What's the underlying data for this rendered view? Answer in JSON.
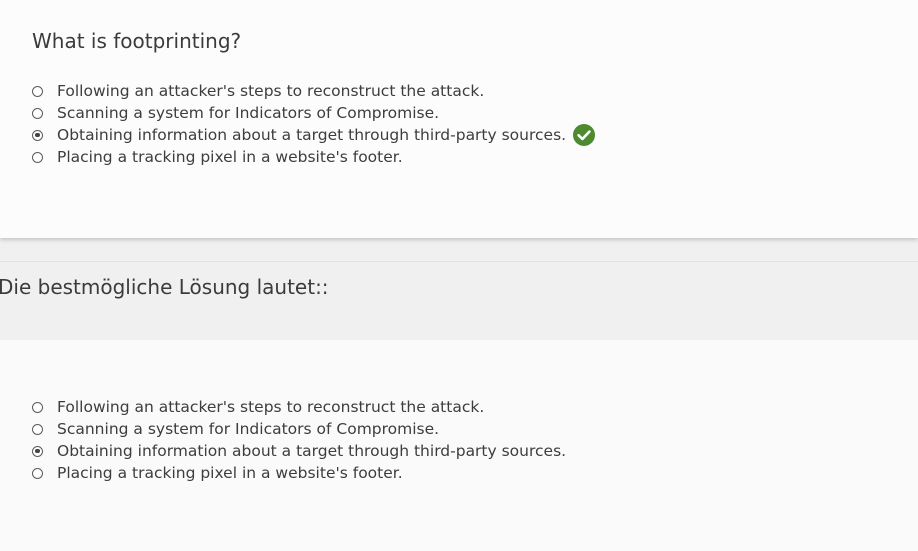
{
  "question": {
    "title": "What is footprinting?",
    "options": [
      {
        "label": "Following an attacker's steps to reconstruct the attack.",
        "selected": false
      },
      {
        "label": "Scanning a system for Indicators of Compromise.",
        "selected": false
      },
      {
        "label": "Obtaining information about a target through third-party sources.",
        "selected": true,
        "correct_icon": "checkmark-circle-icon"
      },
      {
        "label": "Placing a tracking pixel in a website's footer.",
        "selected": false
      }
    ]
  },
  "solution": {
    "title": "Die bestmögliche Lösung lautet::",
    "options": [
      {
        "label": "Following an attacker's steps to reconstruct the attack.",
        "selected": false
      },
      {
        "label": "Scanning a system for Indicators of Compromise.",
        "selected": false
      },
      {
        "label": "Obtaining information about a target through third-party sources.",
        "selected": true
      },
      {
        "label": "Placing a tracking pixel in a website's footer.",
        "selected": false
      }
    ]
  },
  "colors": {
    "correct_green": "#4e8a2f",
    "card_bg": "#fcfcfc",
    "page_bg": "#f0f0f0"
  }
}
